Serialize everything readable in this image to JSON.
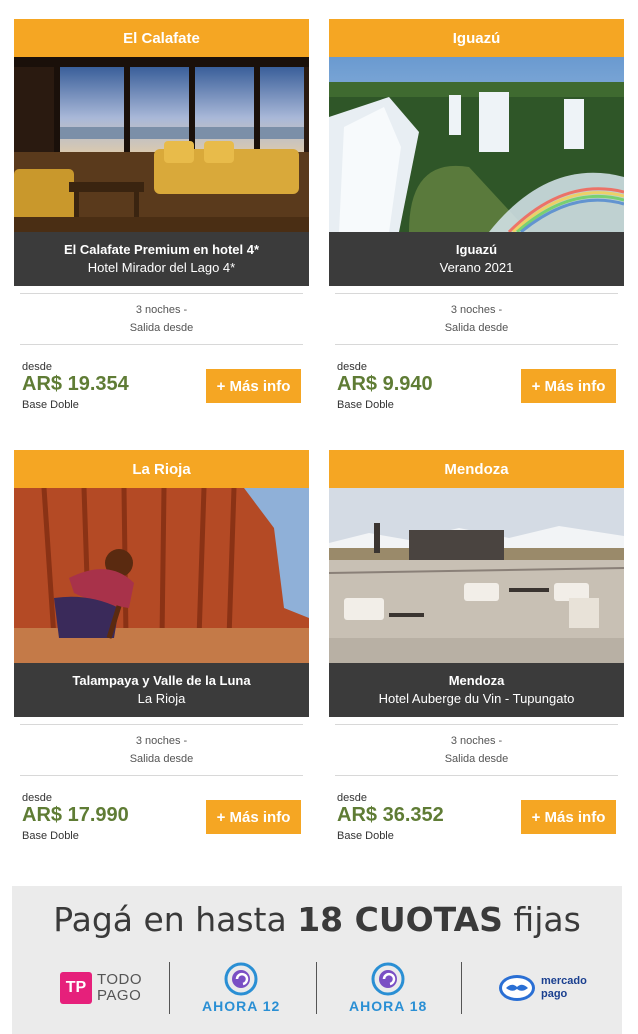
{
  "cards": [
    {
      "header": "El Calafate",
      "image_icon": "hotel-lobby-photo",
      "title": "El Calafate Premium en hotel 4*",
      "subtitle": "Hotel Mirador del Lago 4*",
      "nights": "3 noches -",
      "departure": "Salida desde",
      "price_prefix": "desde",
      "price": "AR$ 19.354",
      "base": "Base Doble",
      "button_label": "+ Más info"
    },
    {
      "header": "Iguazú",
      "image_icon": "waterfall-photo",
      "title": "Iguazú",
      "subtitle": "Verano 2021",
      "nights": "3 noches -",
      "departure": "Salida desde",
      "price_prefix": "desde",
      "price": "AR$ 9.940",
      "base": "Base Doble",
      "button_label": "+ Más info"
    },
    {
      "header": "La Rioja",
      "image_icon": "canyon-photo",
      "title": "Talampaya y Valle de la Luna",
      "subtitle": "La Rioja",
      "nights": "3 noches -",
      "departure": "Salida desde",
      "price_prefix": "desde",
      "price": "AR$ 17.990",
      "base": "Base Doble",
      "button_label": "+ Más info"
    },
    {
      "header": "Mendoza",
      "image_icon": "terrace-photo",
      "title": "Mendoza",
      "subtitle": "Hotel Auberge du Vin - Tupungato",
      "nights": "3 noches -",
      "departure": "Salida desde",
      "price_prefix": "desde",
      "price": "AR$ 36.352",
      "base": "Base Doble",
      "button_label": "+ Más info"
    }
  ],
  "banner": {
    "title_pre": "Pagá en hasta",
    "title_bold": "18 CUOTAS",
    "title_post": "fijas",
    "logos": {
      "todopago_mark": "TP",
      "todopago_line1": "TODO",
      "todopago_line2": "PAGO",
      "ahora12": "AHORA 12",
      "ahora18": "AHORA 18",
      "mercadopago_line1": "mercado",
      "mercadopago_line2": "pago"
    }
  },
  "colors": {
    "accent": "#f5a623",
    "caption_bg": "#3b3b3b",
    "price": "#5f7c35",
    "banner_bg": "#ebebeb"
  }
}
